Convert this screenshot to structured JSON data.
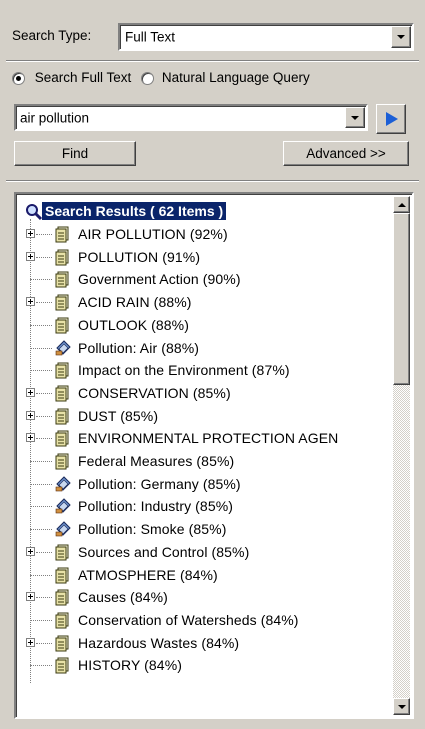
{
  "search_type": {
    "label": "Search Type:",
    "value": "Full Text"
  },
  "mode": {
    "full_text_label": "Search Full Text",
    "natural_label": "Natural Language Query",
    "selected": "full_text"
  },
  "query": {
    "value": "air pollution"
  },
  "buttons": {
    "find": "Find",
    "advanced": "Advanced >>"
  },
  "results": {
    "header": "Search Results ( 62 Items )",
    "items": [
      {
        "label": "AIR POLLUTION (92%)",
        "expandable": true,
        "icon": "book-icon"
      },
      {
        "label": "POLLUTION (91%)",
        "expandable": true,
        "icon": "book-icon"
      },
      {
        "label": "Government Action (90%)",
        "expandable": false,
        "icon": "book-icon"
      },
      {
        "label": "ACID RAIN (88%)",
        "expandable": true,
        "icon": "book-icon"
      },
      {
        "label": "OUTLOOK (88%)",
        "expandable": false,
        "icon": "book-icon"
      },
      {
        "label": "Pollution: Air (88%)",
        "expandable": false,
        "icon": "document-icon"
      },
      {
        "label": "Impact on the Environment (87%)",
        "expandable": false,
        "icon": "book-icon"
      },
      {
        "label": "CONSERVATION (85%)",
        "expandable": true,
        "icon": "book-icon"
      },
      {
        "label": "DUST (85%)",
        "expandable": true,
        "icon": "book-icon"
      },
      {
        "label": "ENVIRONMENTAL PROTECTION AGEN",
        "expandable": true,
        "icon": "book-icon"
      },
      {
        "label": "Federal Measures (85%)",
        "expandable": false,
        "icon": "book-icon"
      },
      {
        "label": "Pollution: Germany (85%)",
        "expandable": false,
        "icon": "document-icon"
      },
      {
        "label": "Pollution: Industry (85%)",
        "expandable": false,
        "icon": "document-icon"
      },
      {
        "label": "Pollution: Smoke (85%)",
        "expandable": false,
        "icon": "document-icon"
      },
      {
        "label": "Sources and Control (85%)",
        "expandable": true,
        "icon": "book-icon"
      },
      {
        "label": "ATMOSPHERE (84%)",
        "expandable": false,
        "icon": "book-icon"
      },
      {
        "label": "Causes (84%)",
        "expandable": true,
        "icon": "book-icon"
      },
      {
        "label": "Conservation of Watersheds (84%)",
        "expandable": false,
        "icon": "book-icon"
      },
      {
        "label": "Hazardous Wastes (84%)",
        "expandable": true,
        "icon": "book-icon"
      },
      {
        "label": "HISTORY (84%)",
        "expandable": false,
        "icon": "book-icon"
      }
    ]
  },
  "colors": {
    "selection": "#0a246a",
    "face": "#d4d0c8",
    "go_arrow": "#1c5fd6"
  }
}
